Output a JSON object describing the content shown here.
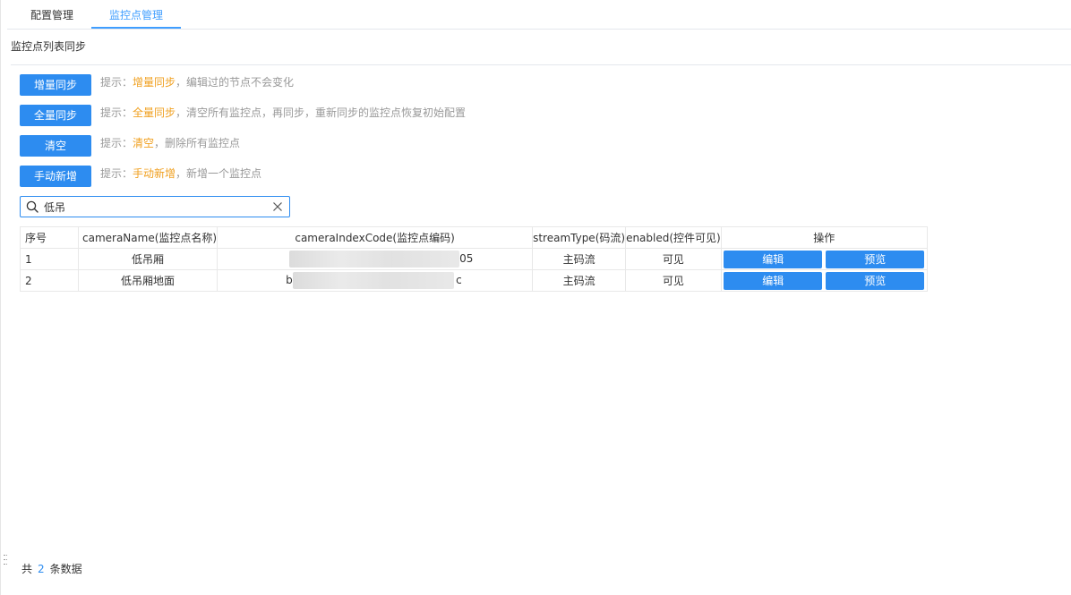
{
  "tabs": [
    {
      "label": "配置管理",
      "active": false
    },
    {
      "label": "监控点管理",
      "active": true
    }
  ],
  "section_title": "监控点列表同步",
  "actions": [
    {
      "button": "增量同步",
      "tip_prefix": "提示：",
      "tip_highlight": "增量同步",
      "tip_rest": "，编辑过的节点不会变化"
    },
    {
      "button": "全量同步",
      "tip_prefix": "提示：",
      "tip_highlight": "全量同步",
      "tip_rest": "，清空所有监控点，再同步，重新同步的监控点恢复初始配置"
    },
    {
      "button": "清空",
      "tip_prefix": "提示：",
      "tip_highlight": "清空",
      "tip_rest": "，删除所有监控点"
    },
    {
      "button": "手动新增",
      "tip_prefix": "提示：",
      "tip_highlight": "手动新增",
      "tip_rest": "，新增一个监控点"
    }
  ],
  "search": {
    "value": "低吊",
    "placeholder": ""
  },
  "table": {
    "headers": [
      "序号",
      "cameraName(监控点名称)",
      "cameraIndexCode(监控点编码)",
      "streamType(码流)",
      "enabled(控件可见)",
      "操作"
    ],
    "rows": [
      {
        "index": "1",
        "name": "低吊厢",
        "code_visible_start": "",
        "code_visible_end": "05",
        "stream": "主码流",
        "enabled": "可见",
        "edit": "编辑",
        "preview": "预览"
      },
      {
        "index": "2",
        "name": "低吊厢地面",
        "code_visible_start": "b",
        "code_visible_end": "c",
        "stream": "主码流",
        "enabled": "可见",
        "edit": "编辑",
        "preview": "预览"
      }
    ]
  },
  "footer": {
    "prefix": "共",
    "count": "2",
    "suffix": "条数据"
  },
  "colors": {
    "accent": "#2d8cf0",
    "tab_active": "#409eff",
    "highlight": "#f0a020",
    "tip": "#999999"
  },
  "icons": {
    "search": "search-icon",
    "clear": "close-icon",
    "resize": "drag-handle-icon"
  }
}
